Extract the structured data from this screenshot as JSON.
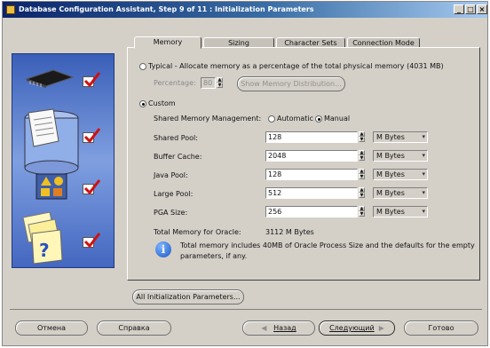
{
  "window": {
    "title": "Database Configuration Assistant, Step 9 of 11 : Initialization Parameters",
    "minimize": "_",
    "maximize": "□",
    "close": "×"
  },
  "tabs": [
    {
      "label": "Memory",
      "active": true
    },
    {
      "label": "Sizing",
      "active": false
    },
    {
      "label": "Character Sets",
      "active": false
    },
    {
      "label": "Connection Mode",
      "active": false
    }
  ],
  "memory": {
    "typical_label": "Typical - Allocate memory as a percentage of the total physical memory (4031 MB)",
    "percentage_label": "Percentage:",
    "percentage_value": "80",
    "show_distribution_button": "Show Memory Distribution...",
    "custom_label": "Custom",
    "shared_mgmt_label": "Shared Memory Management:",
    "automatic_label": "Automatic",
    "manual_label": "Manual",
    "selected_mode": "Custom",
    "selected_management": "Manual",
    "params": [
      {
        "label": "Shared Pool:",
        "value": "128",
        "unit": "M Bytes"
      },
      {
        "label": "Buffer Cache:",
        "value": "2048",
        "unit": "M Bytes"
      },
      {
        "label": "Java Pool:",
        "value": "128",
        "unit": "M Bytes"
      },
      {
        "label": "Large Pool:",
        "value": "512",
        "unit": "M Bytes"
      },
      {
        "label": "PGA Size:",
        "value": "256",
        "unit": "M Bytes"
      }
    ],
    "total_label": "Total Memory for Oracle:",
    "total_value": "3112 M Bytes",
    "info_line1": "Total memory includes 40MB of Oracle Process Size and the defaults for the empty",
    "info_line2": "parameters, if any."
  },
  "all_params_button": "All Initialization Parameters...",
  "footer": {
    "cancel": "Отмена",
    "help": "Справка",
    "back": "Назад",
    "next": "Следующий",
    "finish": "Готово"
  },
  "icons": {
    "app": "oracle-dbca-icon",
    "info": "info-icon"
  }
}
